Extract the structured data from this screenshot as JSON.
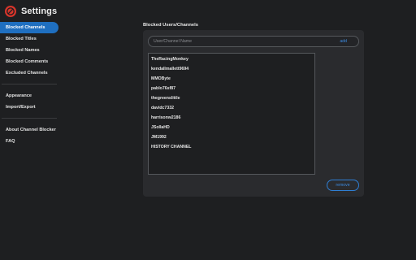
{
  "app": {
    "title": "Settings",
    "accent_color": "#1f6fc0",
    "logo_color": "#d8352b"
  },
  "sidebar": {
    "group1": [
      {
        "label": "Blocked Channels",
        "active": true
      },
      {
        "label": "Blocked Titles",
        "active": false
      },
      {
        "label": "Blocked Names",
        "active": false
      },
      {
        "label": "Blocked Comments",
        "active": false
      },
      {
        "label": "Excluded Channels",
        "active": false
      }
    ],
    "group2": [
      {
        "label": "Appearance"
      },
      {
        "label": "Import/Export"
      }
    ],
    "group3": [
      {
        "label": "About Channel Blocker"
      },
      {
        "label": "FAQ"
      }
    ]
  },
  "main": {
    "section_title": "Blocked Users/Channels",
    "search": {
      "placeholder": "User/Channel Name",
      "value": ""
    },
    "add_label": "add",
    "remove_label": "remove",
    "blocked_list": [
      "TheRacingMonkey",
      "kendallmallett9694",
      "MMOByte",
      "pablo76sf87",
      "thegreenslittle",
      "davidc7332",
      "harrisonw2186",
      "JSollaHD",
      "JM1992",
      "HISTORY CHANNEL"
    ]
  }
}
